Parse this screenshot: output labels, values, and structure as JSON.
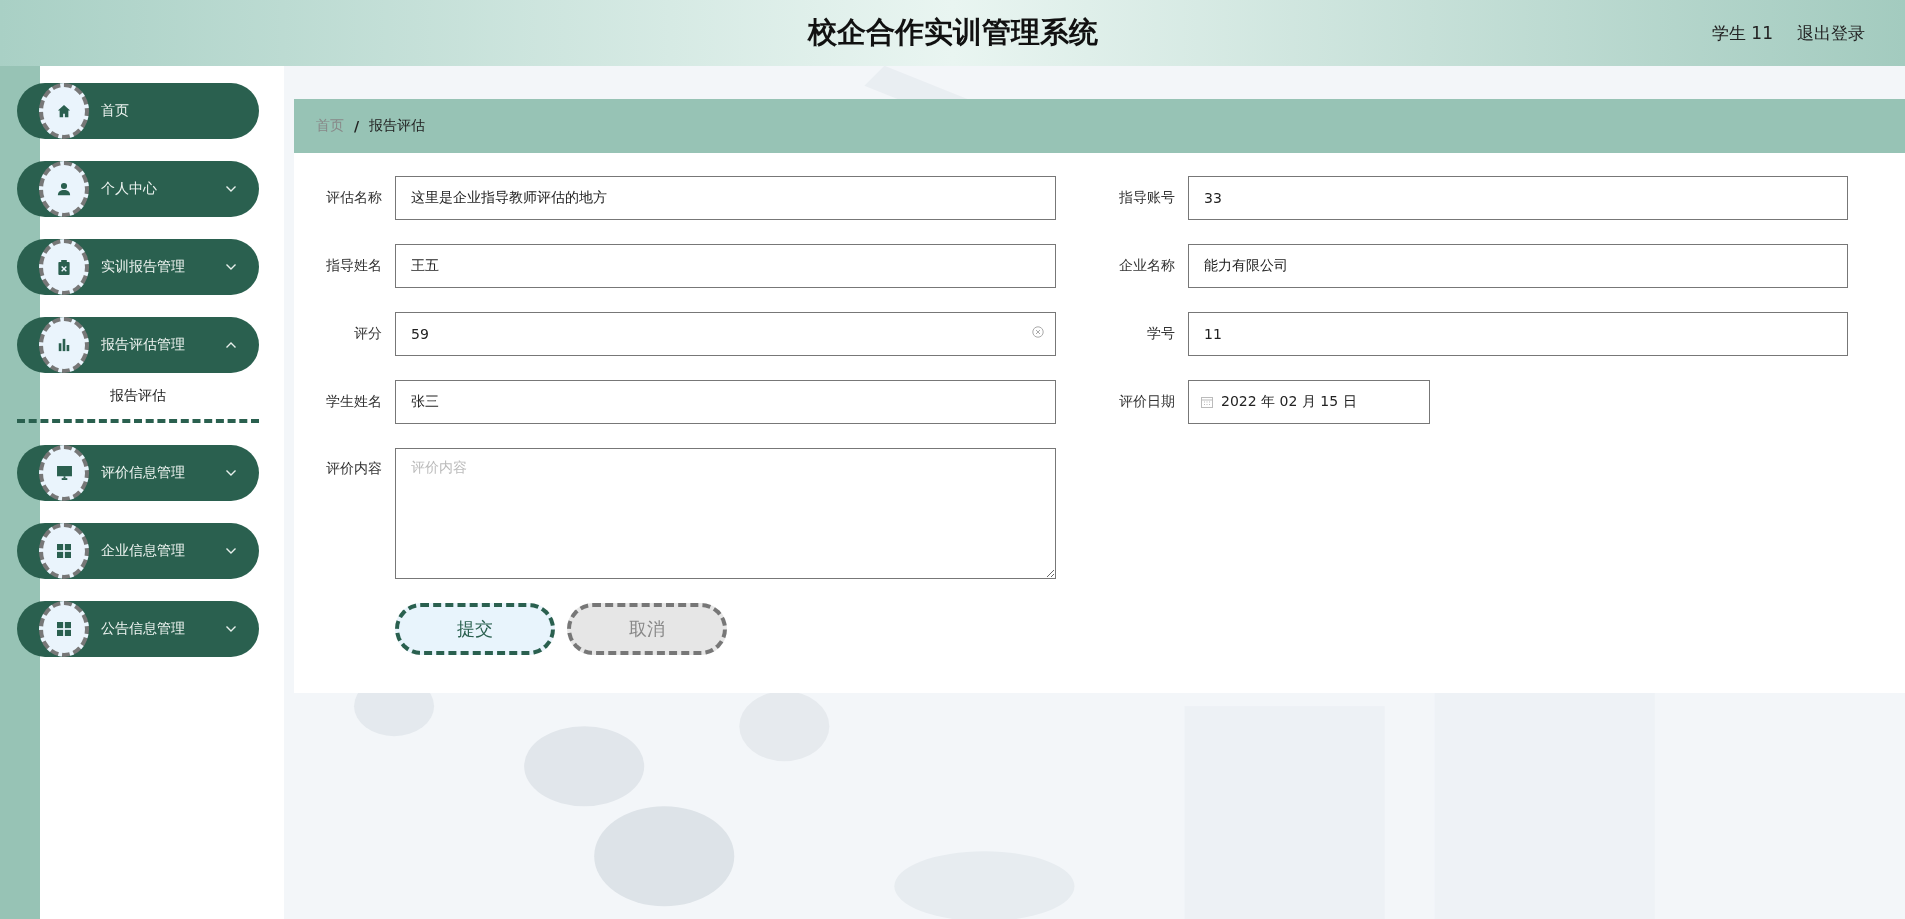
{
  "header": {
    "title": "校企合作实训管理系统",
    "user": "学生 11",
    "logout": "退出登录"
  },
  "sidebar": {
    "items": [
      {
        "label": "首页"
      },
      {
        "label": "个人中心",
        "expanded": false
      },
      {
        "label": "实训报告管理",
        "expanded": false
      },
      {
        "label": "报告评估管理",
        "expanded": true,
        "children": [
          {
            "label": "报告评估",
            "selected": true
          }
        ]
      },
      {
        "label": "评价信息管理",
        "expanded": false
      },
      {
        "label": "企业信息管理",
        "expanded": false
      },
      {
        "label": "公告信息管理",
        "expanded": false
      }
    ]
  },
  "breadcrumb": {
    "items": [
      "首页",
      "报告评估"
    ],
    "separator": "/"
  },
  "form": {
    "left": [
      {
        "label": "评估名称",
        "kind": "text",
        "value": "这里是企业指导教师评估的地方"
      },
      {
        "label": "指导姓名",
        "kind": "text",
        "value": "王五"
      },
      {
        "label": "评分",
        "kind": "text",
        "value": "59",
        "clearable": true
      },
      {
        "label": "学生姓名",
        "kind": "text",
        "value": "张三"
      },
      {
        "label": "评价内容",
        "kind": "textarea",
        "placeholder": "评价内容"
      }
    ],
    "right": [
      {
        "label": "指导账号",
        "kind": "text",
        "value": "33"
      },
      {
        "label": "企业名称",
        "kind": "text",
        "value": "能力有限公司"
      },
      {
        "label": "学号",
        "kind": "text",
        "value": "11"
      },
      {
        "label": "评价日期",
        "kind": "date",
        "value": "2022 年 02 月 15 日"
      }
    ],
    "buttons": [
      {
        "label": "提交",
        "kind": "primary"
      },
      {
        "label": "取消",
        "kind": "cancel"
      }
    ]
  }
}
